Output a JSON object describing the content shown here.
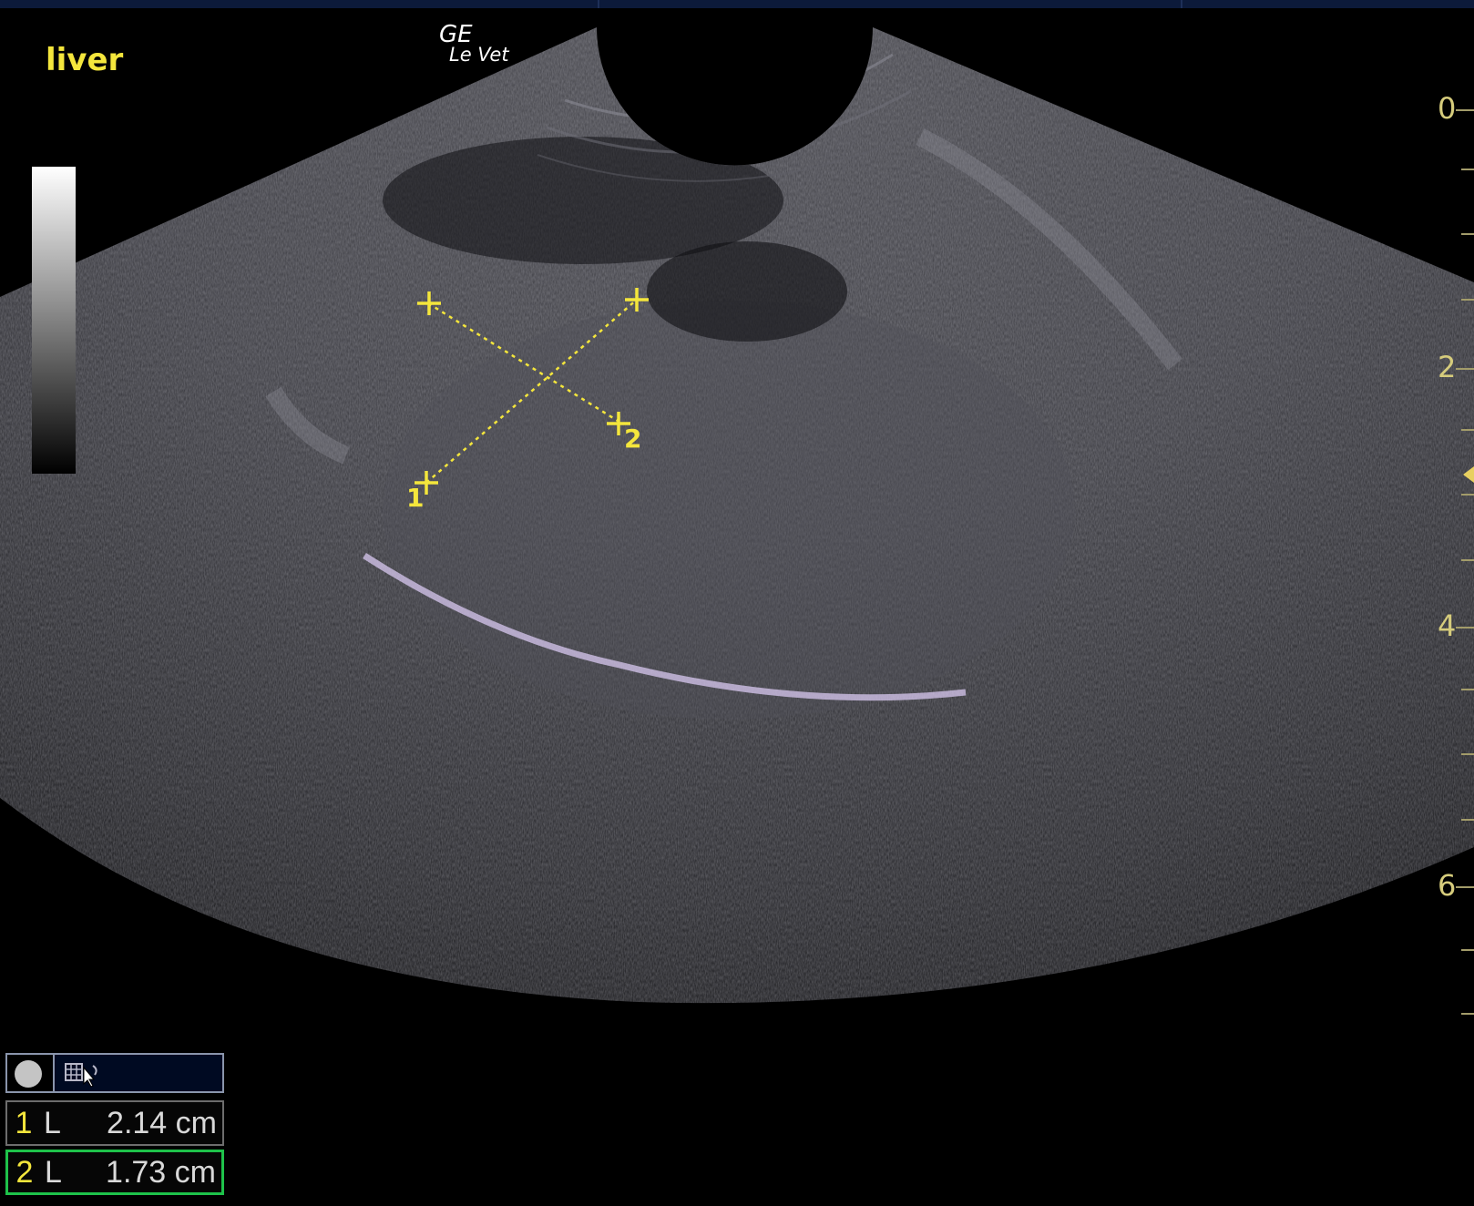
{
  "image_labels": {
    "organ": "liver",
    "logo_line1": "GE",
    "logo_line2": "Le Vet"
  },
  "depth_scale": {
    "labels": [
      "0",
      "2",
      "4",
      "6"
    ],
    "unit": "cm"
  },
  "calipers": [
    {
      "index": "1",
      "label": "1"
    },
    {
      "index": "2",
      "label": "2"
    }
  ],
  "measurement_panel": {
    "tool_icons": [
      "record-circle-icon",
      "caliper-tool-icon"
    ],
    "measurements": [
      {
        "index": "1",
        "type": "L",
        "value": "2.14 cm",
        "active": false
      },
      {
        "index": "2",
        "type": "L",
        "value": "1.73 cm",
        "active": true
      }
    ]
  },
  "colors": {
    "annotation_yellow": "#f4e63c",
    "active_border": "#1ec24a",
    "scale_text": "#d6cc7c"
  }
}
